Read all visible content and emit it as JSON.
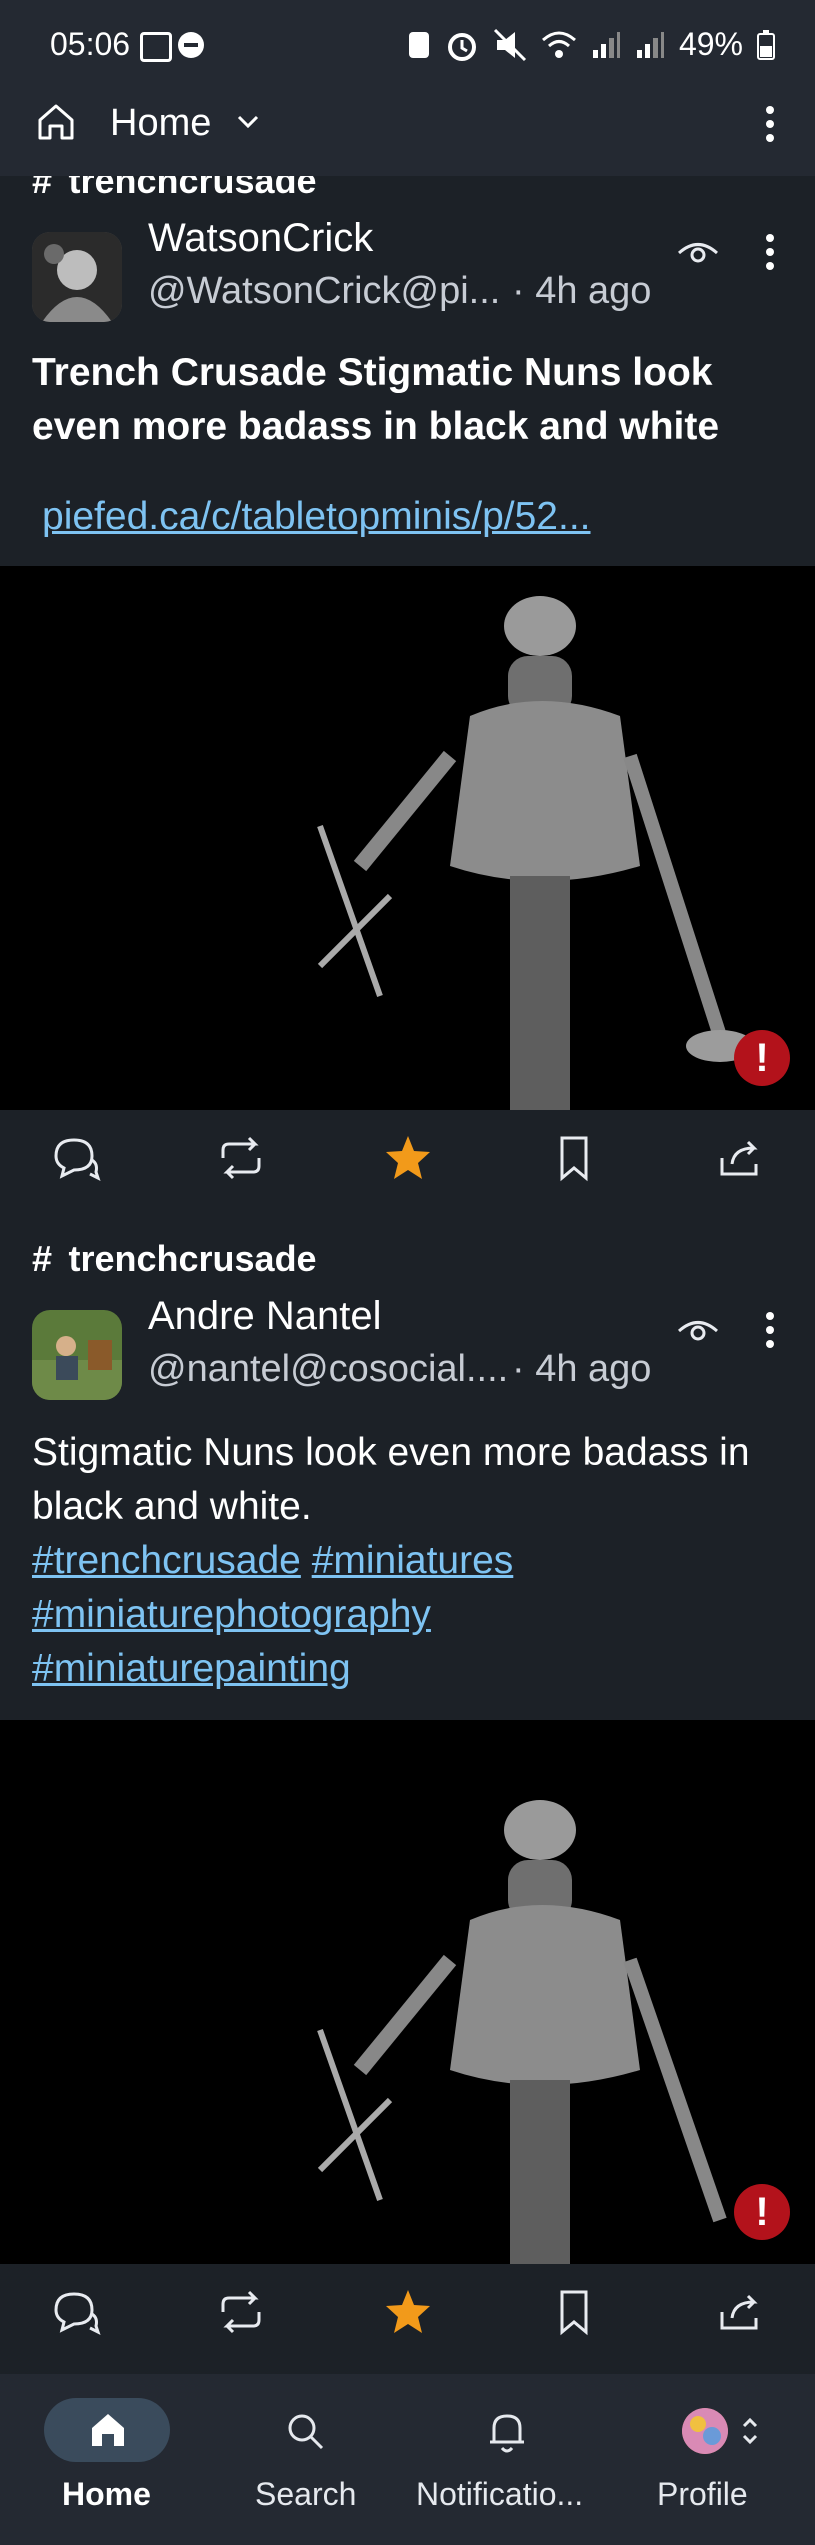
{
  "status": {
    "time": "05:06",
    "battery": "49%"
  },
  "header": {
    "title": "Home"
  },
  "posts": [
    {
      "hashtag_prefix": "#",
      "hashtag": "trenchcrusade",
      "author_name": "WatsonCrick",
      "author_handle": "@WatsonCrick@pi...",
      "time": "· 4h ago",
      "title": "Trench Crusade Stigmatic Nuns look even more badass in black and white",
      "link": "piefed.ca/c/tabletopminis/p/52..."
    },
    {
      "hashtag_prefix": "#",
      "hashtag": "trenchcrusade",
      "author_name": "Andre Nantel",
      "author_handle": "@nantel@cosocial....",
      "time": "· 4h ago",
      "text": "Stigmatic Nuns look even more badass in black and white.",
      "tags": [
        "#trenchcrusade",
        "#miniatures",
        "#miniaturephotography",
        "#miniaturepainting"
      ]
    }
  ],
  "bottom_nav": {
    "home": "Home",
    "search": "Search",
    "notifications": "Notificatio...",
    "profile": "Profile"
  },
  "colors": {
    "accent_star": "#f29a1a",
    "link": "#7ec3f2",
    "alert_red": "#b3121b"
  }
}
